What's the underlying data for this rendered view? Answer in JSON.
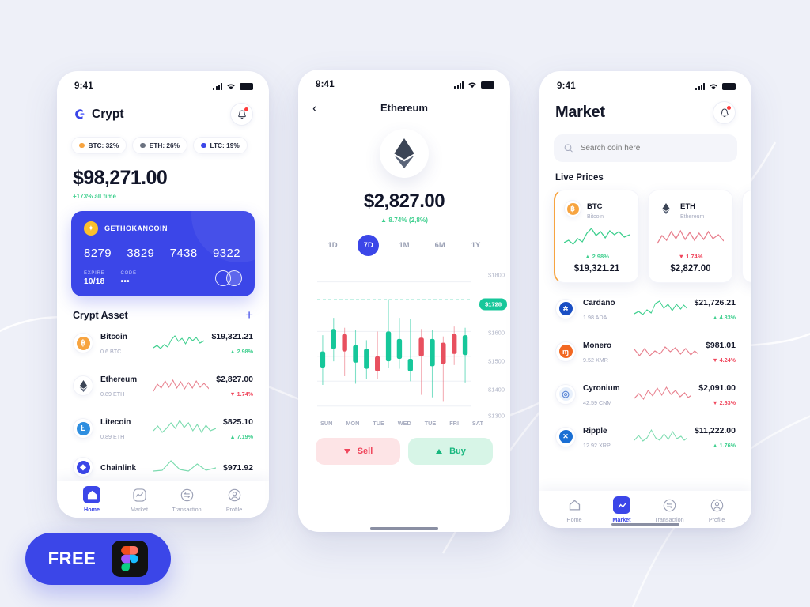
{
  "background_color": "#eef0f8",
  "accent_color": "#3b46e8",
  "up_color": "#3ecf8e",
  "down_color": "#f0465c",
  "status_bar": {
    "time": "9:41",
    "signal_icon": "signal-bars-icon",
    "wifi_icon": "wifi-icon",
    "battery_icon": "battery-full-icon"
  },
  "phone_home": {
    "brand": {
      "name": "Crypt",
      "logo_icon": "crypt-logo-icon"
    },
    "notification": {
      "icon": "bell-icon",
      "has_badge": true
    },
    "pills": [
      {
        "label": "BTC: 32%",
        "color": "#f7a440"
      },
      {
        "label": "ETH: 26%",
        "color": "#6b7280"
      },
      {
        "label": "LTC: 19%",
        "color": "#3b46e8"
      }
    ],
    "balance": {
      "amount": "$98,271.00",
      "subtitle": "+173% all time"
    },
    "card": {
      "brand": "GETHOKANCOIN",
      "coin_icon": "coin-icon",
      "numbers": [
        "8279",
        "3829",
        "7438",
        "9322"
      ],
      "expire_label": "EXPIRE",
      "expire_value": "10/18",
      "code_label": "CODE",
      "code_value": "•••",
      "network_icon": "mastercard-icon"
    },
    "assets_section": {
      "title": "Crypt Asset",
      "add_icon": "plus-icon"
    },
    "assets": [
      {
        "name": "Bitcoin",
        "holding": "0.6 BTC",
        "price": "$19,321.21",
        "change": "2.98%",
        "direction": "up",
        "symbol": "B",
        "icon_bg": "#f7a440",
        "spark": "green"
      },
      {
        "name": "Ethereum",
        "holding": "0.89 ETH",
        "price": "$2,827.00",
        "change": "1.74%",
        "direction": "down",
        "symbol": "E",
        "icon_bg": "#3c4556",
        "spark": "red"
      },
      {
        "name": "Litecoin",
        "holding": "0.89 ETH",
        "price": "$825.10",
        "change": "7.19%",
        "direction": "up",
        "symbol": "L",
        "icon_bg": "#2f8fe0",
        "spark": "green"
      },
      {
        "name": "Chainlink",
        "holding": "",
        "price": "$971.92",
        "change": "",
        "direction": "up",
        "symbol": "C",
        "icon_bg": "#3b46e8",
        "spark": "green"
      }
    ],
    "tabs": [
      {
        "label": "Home",
        "icon": "home-icon",
        "active": true
      },
      {
        "label": "Market",
        "icon": "chart-icon",
        "active": false
      },
      {
        "label": "Transaction",
        "icon": "exchange-icon",
        "active": false
      },
      {
        "label": "Profile",
        "icon": "person-icon",
        "active": false
      }
    ]
  },
  "phone_detail": {
    "back_icon": "chevron-left-icon",
    "title": "Ethereum",
    "coin_icon": "ethereum-icon",
    "price": "$2,827.00",
    "change": "8.74% (2,8%)",
    "change_direction": "up",
    "ranges": [
      {
        "label": "1D",
        "active": false
      },
      {
        "label": "7D",
        "active": true
      },
      {
        "label": "1M",
        "active": false
      },
      {
        "label": "6M",
        "active": false
      },
      {
        "label": "1Y",
        "active": false
      }
    ],
    "actions": [
      {
        "label": "Sell",
        "icon": "arrow-down-icon",
        "type": "sell"
      },
      {
        "label": "Buy",
        "icon": "arrow-up-icon",
        "type": "buy"
      }
    ]
  },
  "chart_data": {
    "type": "candlestick",
    "title": "Ethereum 7D price",
    "xlabel": "",
    "ylabel": "",
    "ylim": [
      1280,
      1840
    ],
    "yticks": [
      "$1300",
      "$1400",
      "$1500",
      "$1600",
      "$1800"
    ],
    "ytick_values": [
      1300,
      1400,
      1500,
      1600,
      1800
    ],
    "grid": true,
    "marker": {
      "label": "$1728",
      "value": 1728,
      "color": "#16c79a",
      "dashed_line": true
    },
    "xtick_labels": [
      "SUN",
      "MON",
      "TUE",
      "WED",
      "TUE",
      "FRI",
      "SAT"
    ],
    "candles": [
      {
        "open": 1455,
        "close": 1520,
        "low": 1385,
        "high": 1585,
        "dir": "up"
      },
      {
        "open": 1530,
        "close": 1610,
        "low": 1480,
        "high": 1655,
        "dir": "up"
      },
      {
        "open": 1590,
        "close": 1520,
        "low": 1420,
        "high": 1615,
        "dir": "down"
      },
      {
        "open": 1475,
        "close": 1545,
        "low": 1390,
        "high": 1605,
        "dir": "up"
      },
      {
        "open": 1450,
        "close": 1530,
        "low": 1410,
        "high": 1565,
        "dir": "up"
      },
      {
        "open": 1500,
        "close": 1440,
        "low": 1410,
        "high": 1600,
        "dir": "down"
      },
      {
        "open": 1480,
        "close": 1600,
        "low": 1455,
        "high": 1730,
        "dir": "up"
      },
      {
        "open": 1490,
        "close": 1570,
        "low": 1450,
        "high": 1655,
        "dir": "up"
      },
      {
        "open": 1490,
        "close": 1440,
        "low": 1400,
        "high": 1650,
        "dir": "up"
      },
      {
        "open": 1575,
        "close": 1500,
        "low": 1345,
        "high": 1610,
        "dir": "down"
      },
      {
        "open": 1460,
        "close": 1570,
        "low": 1335,
        "high": 1605,
        "dir": "up"
      },
      {
        "open": 1555,
        "close": 1470,
        "low": 1320,
        "high": 1580,
        "dir": "down"
      },
      {
        "open": 1590,
        "close": 1510,
        "low": 1465,
        "high": 1620,
        "dir": "down"
      },
      {
        "open": 1505,
        "close": 1585,
        "low": 1395,
        "high": 1615,
        "dir": "up"
      }
    ]
  },
  "phone_market": {
    "title": "Market",
    "notification": {
      "icon": "bell-icon",
      "has_badge": true
    },
    "search": {
      "placeholder": "Search coin here",
      "value": "",
      "icon": "search-icon"
    },
    "live_prices_title": "Live Prices",
    "live_cards": [
      {
        "symbol": "BTC",
        "name": "Bitcoin",
        "change": "2.98%",
        "direction": "up",
        "price": "$19,321.21",
        "icon_bg": "#f7a440",
        "glyph": "B"
      },
      {
        "symbol": "ETH",
        "name": "Ethereum",
        "change": "1.74%",
        "direction": "down",
        "price": "$2,827.00",
        "icon_bg": "#3c4556",
        "glyph": "E"
      }
    ],
    "market_rows": [
      {
        "name": "Cardano",
        "holding": "1.98 ADA",
        "price": "$21,726.21",
        "change": "4.83%",
        "direction": "up",
        "icon_bg": "#1a4fc4",
        "glyph": "₳",
        "spark": "green"
      },
      {
        "name": "Monero",
        "holding": "9.52 XMR",
        "price": "$981.01",
        "change": "4.24%",
        "direction": "down",
        "icon_bg": "#f26822",
        "glyph": "ɱ",
        "spark": "red"
      },
      {
        "name": "Cyronium",
        "holding": "42.59 CNM",
        "price": "$2,091.00",
        "change": "2.63%",
        "direction": "down",
        "icon_bg": "#e8f0fb",
        "glyph": "◎",
        "spark": "red"
      },
      {
        "name": "Ripple",
        "holding": "12.92 XRP",
        "price": "$11,222.00",
        "change": "1.76%",
        "direction": "up",
        "icon_bg": "#1a6fd4",
        "glyph": "✕",
        "spark": "green"
      }
    ],
    "tabs": [
      {
        "label": "Home",
        "icon": "home-icon",
        "active": false
      },
      {
        "label": "Market",
        "icon": "chart-icon",
        "active": true
      },
      {
        "label": "Transaction",
        "icon": "exchange-icon",
        "active": false
      },
      {
        "label": "Profile",
        "icon": "person-icon",
        "active": false
      }
    ]
  },
  "free_badge": {
    "label": "FREE",
    "logo_icon": "figma-logo-icon"
  }
}
